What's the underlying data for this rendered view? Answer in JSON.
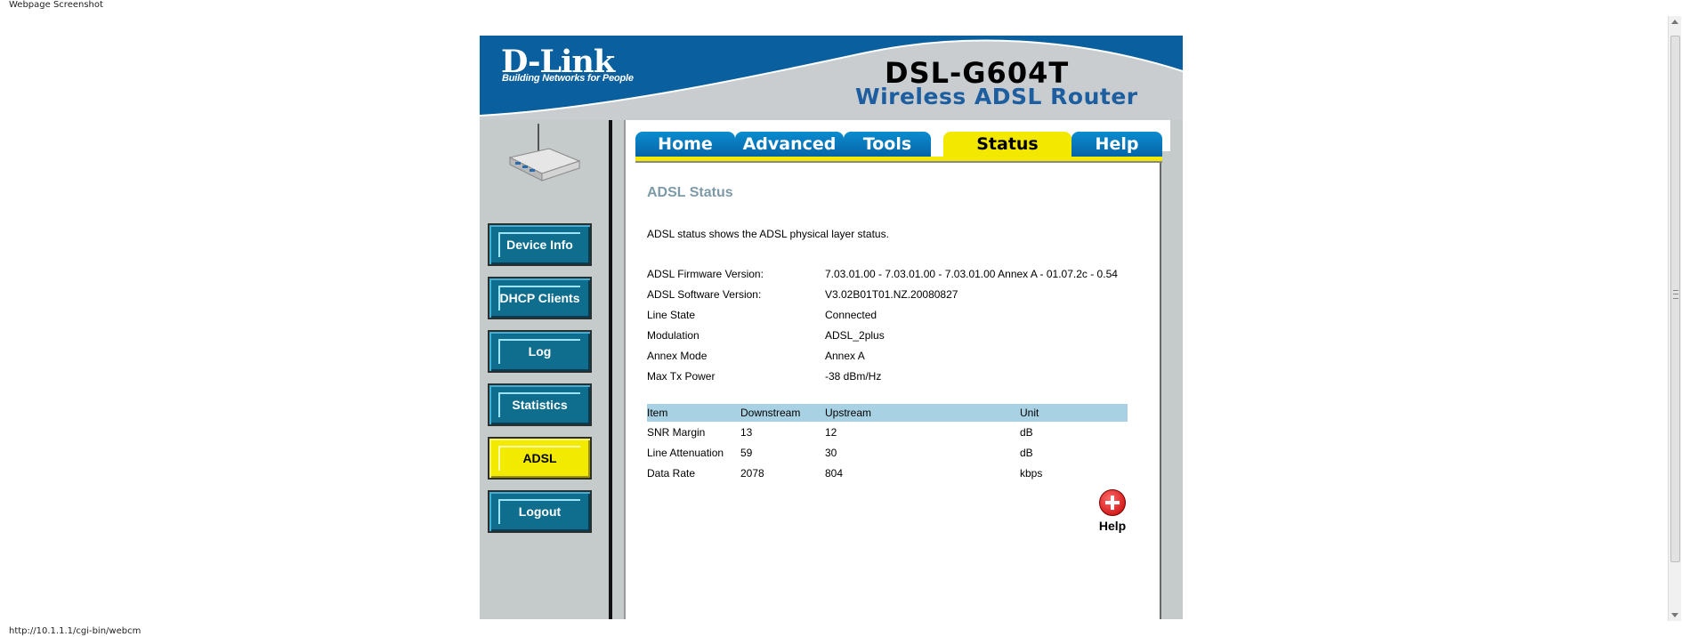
{
  "browser": {
    "caption": "Webpage Screenshot",
    "status_url": "http://10.1.1.1/cgi-bin/webcm"
  },
  "header": {
    "logo": "D-Link",
    "logo_tagline": "Building Networks for People",
    "model": "DSL-G604T",
    "model_description": "Wireless ADSL Router"
  },
  "tabs": [
    {
      "label": "Home"
    },
    {
      "label": "Advanced"
    },
    {
      "label": "Tools"
    },
    {
      "label": "Status"
    },
    {
      "label": "Help"
    }
  ],
  "sidebar": {
    "items": [
      {
        "label": "Device Info"
      },
      {
        "label": "DHCP Clients"
      },
      {
        "label": "Log"
      },
      {
        "label": "Statistics"
      },
      {
        "label": "ADSL"
      },
      {
        "label": "Logout"
      }
    ]
  },
  "main": {
    "title": "ADSL Status",
    "description": "ADSL status shows the ADSL physical layer status.",
    "info": [
      {
        "label": "ADSL Firmware Version:",
        "value": "7.03.01.00 - 7.03.01.00 - 7.03.01.00 Annex A - 01.07.2c - 0.54"
      },
      {
        "label": "ADSL Software Version:",
        "value": "V3.02B01T01.NZ.20080827"
      },
      {
        "label": "Line State",
        "value": "Connected"
      },
      {
        "label": "Modulation",
        "value": "ADSL_2plus"
      },
      {
        "label": "Annex Mode",
        "value": "Annex A"
      },
      {
        "label": "Max Tx Power",
        "value": "-38 dBm/Hz"
      }
    ],
    "table": {
      "headers": [
        "Item",
        "Downstream",
        "Upstream",
        "Unit"
      ],
      "rows": [
        [
          "SNR Margin",
          "13",
          "12",
          "dB"
        ],
        [
          "Line Attenuation",
          "59",
          "30",
          "dB"
        ],
        [
          "Data Rate",
          "2078",
          "804",
          "kbps"
        ]
      ]
    },
    "help_label": "Help"
  },
  "colors": {
    "header_blue": "#0a5f9e",
    "tab_blue": "#0a8dcf",
    "active_yellow": "#f2e800",
    "table_header": "#a8d2e4",
    "title_gray": "#7d9aa8"
  }
}
